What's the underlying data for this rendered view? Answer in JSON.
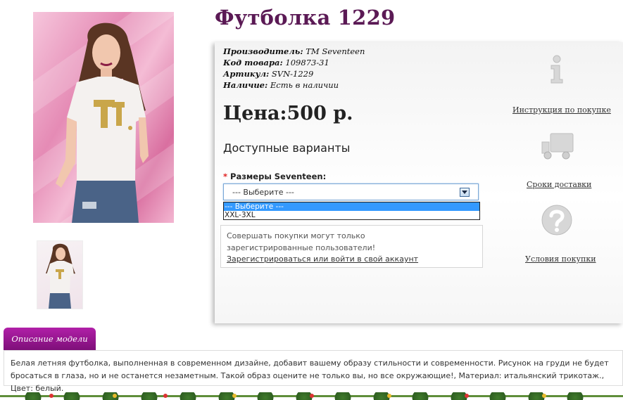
{
  "product": {
    "title": "Футболка 1229",
    "manufacturer_label": "Производитель:",
    "manufacturer": "TM Seventeen",
    "code_label": "Код товара:",
    "code": "109873-31",
    "article_label": "Артикул:",
    "article": "SVN-1229",
    "stock_label": "Наличие:",
    "stock": "Есть в наличии",
    "price": "Цена:500 р."
  },
  "options": {
    "heading": "Доступные варианты",
    "required_mark": "*",
    "size_label": "Размеры Seventeen:",
    "selected": "--- Выберите ---",
    "dropdown_items": [
      "--- Выберите ---",
      "XXL-3XL"
    ]
  },
  "notice": {
    "text": "Совершать покупки могут только зарегистрированные пользователи!",
    "link": "Зарегистрироваться или войти в свой аккаунт"
  },
  "side": {
    "instruction": "Инструкция по покупке",
    "delivery": "Сроки доставки",
    "conditions": "Условия покупки"
  },
  "icons": {
    "info": "info-icon",
    "truck": "truck-icon",
    "question": "question-icon"
  },
  "description": {
    "tab": "Описание модели",
    "text": "Белая летняя футболка, выполненная в современном дизайне, добавит вашему образу стильности и современности. Рисунок на груди не будет бросаться в глаза, но и не останется незаметным. Такой образ оцените не только вы, но все окружающие!, Материал: итальянский трикотаж., Цвет: белый."
  },
  "colors": {
    "title": "#5b1a55",
    "tab": "#9a1794",
    "selected_option": "#3399ff"
  }
}
